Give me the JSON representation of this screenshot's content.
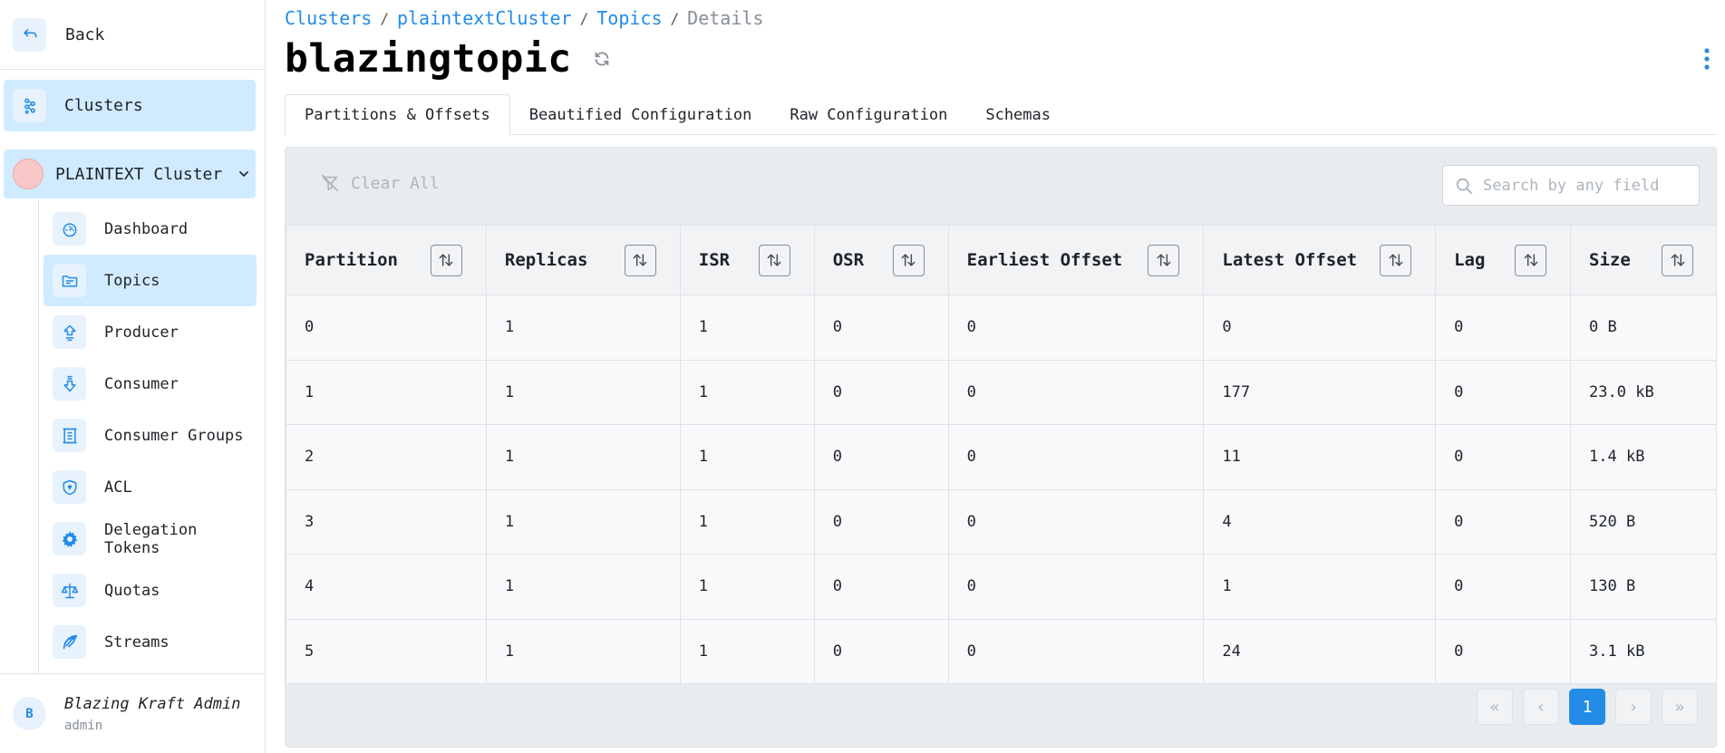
{
  "sidebar": {
    "back_label": "Back",
    "clusters_label": "Clusters",
    "cluster_name": "PLAINTEXT Cluster",
    "cluster_color": "#f9c7c7",
    "items": [
      {
        "label": "Dashboard",
        "icon": "gauge-icon"
      },
      {
        "label": "Topics",
        "icon": "folder-icon"
      },
      {
        "label": "Producer",
        "icon": "upload-arrow-icon"
      },
      {
        "label": "Consumer",
        "icon": "download-arrow-icon"
      },
      {
        "label": "Consumer Groups",
        "icon": "building-icon"
      },
      {
        "label": "ACL",
        "icon": "shield-icon"
      },
      {
        "label": "Delegation Tokens",
        "icon": "gear-icon"
      },
      {
        "label": "Quotas",
        "icon": "scale-icon"
      },
      {
        "label": "Streams",
        "icon": "feather-icon"
      }
    ],
    "active_item": "Topics",
    "user": {
      "avatar_letter": "B",
      "name": "Blazing Kraft Admin",
      "role": "admin"
    }
  },
  "breadcrumb": {
    "items": [
      "Clusters",
      "plaintextCluster",
      "Topics"
    ],
    "separator": "/",
    "current": "Details"
  },
  "page_title": "blazingtopic",
  "tabs": [
    "Partitions & Offsets",
    "Beautified Configuration",
    "Raw Configuration",
    "Schemas"
  ],
  "active_tab": "Partitions & Offsets",
  "toolbar": {
    "clear_all_label": "Clear All",
    "search_placeholder": "Search by any field",
    "search_value": ""
  },
  "table": {
    "columns": [
      "Partition",
      "Replicas",
      "ISR",
      "OSR",
      "Earliest Offset",
      "Latest Offset",
      "Lag",
      "Size"
    ],
    "rows": [
      [
        "0",
        "1",
        "1",
        "0",
        "0",
        "0",
        "0",
        "0 B"
      ],
      [
        "1",
        "1",
        "1",
        "0",
        "0",
        "177",
        "0",
        "23.0 kB"
      ],
      [
        "2",
        "1",
        "1",
        "0",
        "0",
        "11",
        "0",
        "1.4 kB"
      ],
      [
        "3",
        "1",
        "1",
        "0",
        "0",
        "4",
        "0",
        "520 B"
      ],
      [
        "4",
        "1",
        "1",
        "0",
        "0",
        "1",
        "0",
        "130 B"
      ],
      [
        "5",
        "1",
        "1",
        "0",
        "0",
        "24",
        "0",
        "3.1 kB"
      ]
    ],
    "red_columns": [
      "OSR",
      "Lag"
    ]
  },
  "pagination": {
    "first": "«",
    "prev": "‹",
    "current_page": "1",
    "next": "›",
    "last": "»"
  },
  "colors": {
    "accent": "#228be6",
    "active_bg": "#d0ebff",
    "warning_text": "#fa5252"
  }
}
